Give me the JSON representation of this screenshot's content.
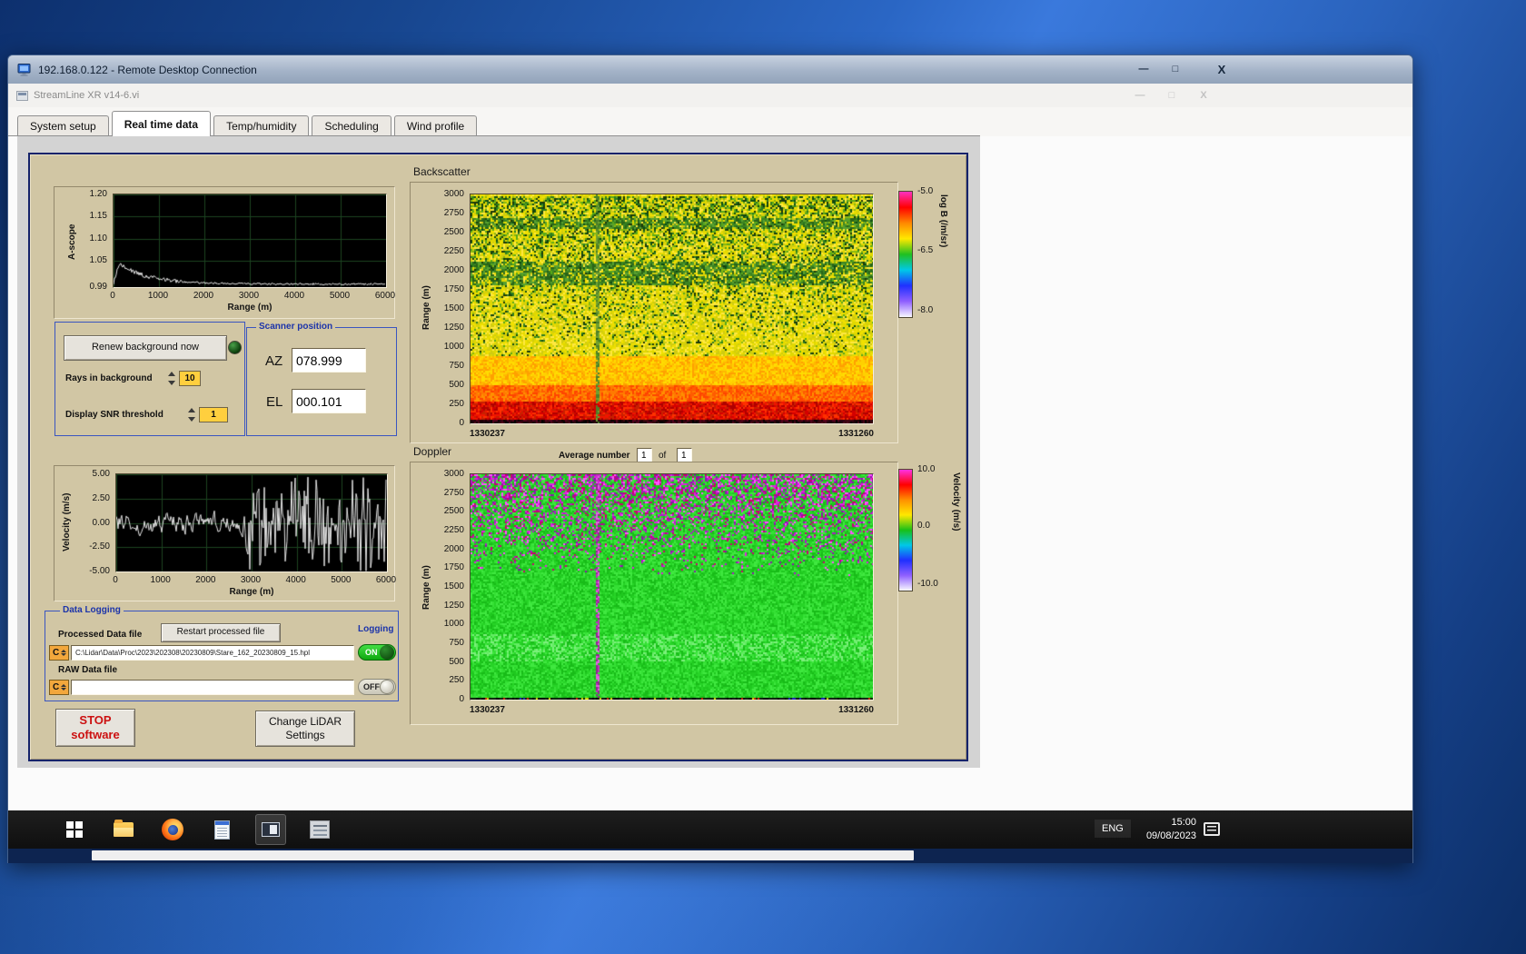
{
  "rdp_window": {
    "title": "192.168.0.122 - Remote Desktop Connection"
  },
  "icons": {
    "minimize": "—",
    "maximize": "□",
    "close": "X"
  },
  "app_window": {
    "title": "StreamLine XR v14-6.vi"
  },
  "tabs": [
    {
      "label": "System setup",
      "active": false
    },
    {
      "label": "Real time data",
      "active": true
    },
    {
      "label": "Temp/humidity",
      "active": false
    },
    {
      "label": "Scheduling",
      "active": false
    },
    {
      "label": "Wind profile",
      "active": false
    }
  ],
  "controls_panel": {
    "renew_button": "Renew background now",
    "rays_label": "Rays in background",
    "rays_value": "10",
    "snr_label": "Display SNR threshold",
    "snr_value": "1"
  },
  "scanner_position": {
    "title": "Scanner position",
    "az_label": "AZ",
    "az_value": "078.999",
    "el_label": "EL",
    "el_value": "000.101"
  },
  "doppler_header": {
    "average_label": "Average number",
    "average_value": "1",
    "of_label": "of",
    "average_total": "1"
  },
  "data_logging": {
    "title": "Data Logging",
    "processed_label": "Processed Data file",
    "restart_button": "Restart processed file",
    "logging_label": "Logging",
    "drive_letter": "C",
    "processed_path": "C:\\Lidar\\Data\\Proc\\2023\\202308\\20230809\\Stare_162_20230809_15.hpl",
    "processed_toggle": "ON",
    "raw_label": "RAW Data file",
    "raw_path": "",
    "raw_toggle": "OFF"
  },
  "buttons": {
    "stop_line1": "STOP",
    "stop_line2": "software",
    "change_line1": "Change LiDAR",
    "change_line2": "Settings"
  },
  "taskbar": {
    "language": "ENG",
    "time": "15:00",
    "date": "09/08/2023"
  },
  "chart_data": [
    {
      "id": "a_scope",
      "type": "line",
      "ylabel": "A-scope",
      "xlabel": "Range (m)",
      "xlim": [
        0,
        6000
      ],
      "ylim": [
        0.99,
        1.2
      ],
      "yticks": [
        "1.20",
        "1.15",
        "1.10",
        "1.05",
        "0.99"
      ],
      "xticks": [
        0,
        1000,
        2000,
        3000,
        4000,
        5000,
        6000
      ],
      "bg": "#000000",
      "grid_color": "#1c4420",
      "line_color": "#e6e6e6",
      "gen": {
        "floor": 0.997,
        "peak": 1.052,
        "tau": 650,
        "ramp": 120,
        "noise": 0.006
      },
      "description": "Background A-scope amplitude vs range: ~1.05 near 0 m decaying to ~1.00 beyond 1500 m with small noise."
    },
    {
      "id": "backscatter",
      "type": "heatmap",
      "title": "Backscatter",
      "ylabel": "Range (m)",
      "ylim": [
        0,
        3000
      ],
      "yticks": [
        "3000",
        "2750",
        "2500",
        "2250",
        "2000",
        "1750",
        "1500",
        "1250",
        "1000",
        "750",
        "500",
        "250",
        "0"
      ],
      "x_start_label": "1330237",
      "x_end_label": "1331260",
      "colorbar": {
        "label": "log B (/m/sr)",
        "ticks": [
          "-5.0",
          "-6.5",
          "-8.0"
        ],
        "colors": [
          "#ff30c0",
          "#ff0000",
          "#ff8800",
          "#ffe800",
          "#20c020",
          "#00c8e8",
          "#2030ff",
          "#9060ff",
          "#f8f8ff"
        ]
      },
      "paint": {
        "bands": [
          {
            "to": 55,
            "colors": [
              "#180004",
              "#3a0410",
              "#000000",
              "#52001e",
              "#240010"
            ]
          },
          {
            "to": 300,
            "colors": [
              "#d40000",
              "#ef1500",
              "#b00000",
              "#ff3000",
              "#c82000"
            ]
          },
          {
            "to": 520,
            "colors": [
              "#ff5c00",
              "#ff7a00",
              "#ff4400",
              "#ff9000"
            ]
          },
          {
            "to": 900,
            "colors": [
              "#ffb800",
              "#ffd000",
              "#ffa000",
              "#ffdc00"
            ]
          },
          {
            "to": 3000,
            "colors": [
              "#f0e000",
              "#e0d800",
              "#ffe840",
              "#d0cc10"
            ],
            "speckle": [
              "#58a818",
              "#2c7c20",
              "#0e4c14",
              "#88b810",
              "#1a3808"
            ],
            "density0": 0.1,
            "density1": 0.52
          }
        ],
        "dark_bands": [
          [
            1830,
            2130
          ],
          [
            2560,
            2700
          ]
        ],
        "dark_colors": [
          "#3c8420",
          "#2a6418",
          "#58a030"
        ],
        "vline_frac": 0.315,
        "vline_colors": [
          "#70a030",
          "#4c8028"
        ]
      },
      "description": "Time-height backscatter: strong red/orange returns below 500 m fading through yellow to speckled yellow-green aloft; faint disturbed column about one third across."
    },
    {
      "id": "velocity",
      "type": "line",
      "ylabel": "Velocity (m/s)",
      "xlabel": "Range (m)",
      "xlim": [
        0,
        6000
      ],
      "ylim": [
        -5,
        5
      ],
      "yticks": [
        "5.00",
        "2.50",
        "0.00",
        "-2.50",
        "-5.00"
      ],
      "xticks": [
        0,
        1000,
        2000,
        3000,
        4000,
        5000,
        6000
      ],
      "bg": "#000000",
      "grid_color": "#1c4420",
      "line_color": "#e6e6e6",
      "gen": {
        "noise_amp": 1.6,
        "spike_from": 2850,
        "spike_density": 0.78
      },
      "description": "Radial velocity vs range: small fluctuations about 0 out to ~2800 m, full-scale uncorrelated noise beyond."
    },
    {
      "id": "doppler",
      "type": "heatmap",
      "title": "Doppler",
      "ylabel": "Range (m)",
      "ylim": [
        0,
        3000
      ],
      "yticks": [
        "3000",
        "2750",
        "2500",
        "2250",
        "2000",
        "1750",
        "1500",
        "1250",
        "1000",
        "750",
        "500",
        "250",
        "0"
      ],
      "x_start_label": "1330237",
      "x_end_label": "1331260",
      "colorbar": {
        "label": "Velocity (m/s)",
        "ticks": [
          "10.0",
          "0.0",
          "-10.0"
        ],
        "colors": [
          "#ff30e0",
          "#ff0000",
          "#ff9000",
          "#ffe800",
          "#18c018",
          "#00c8e8",
          "#2030ff",
          "#9060ff",
          "#f8f8ff"
        ]
      },
      "paint": {
        "base": [
          "#27d427",
          "#1fc81f",
          "#35e035",
          "#18bc18",
          "#40e840"
        ],
        "light_band": {
          "from": 520,
          "to": 880,
          "colors": [
            "#64ec64",
            "#7cf07c"
          ],
          "density": 0.35
        },
        "speckle": {
          "from": 1650,
          "colors": [
            "#e020e0",
            "#b018c8",
            "#ff50ff",
            "#cc0070",
            "#8818a8"
          ],
          "density1": 0.55
        },
        "vline_frac": 0.315,
        "vline_colors": [
          "#c030c0",
          "#902890",
          "#e060e0"
        ],
        "bottom": {
          "height": 45,
          "dark": [
            "#000000",
            "#141414",
            "#082008"
          ],
          "bright": [
            "#d02000",
            "#d8d800",
            "#2020c0"
          ],
          "dark_prob": 0.85
        }
      },
      "description": "Time-height Doppler velocity: near-zero (green) everywhere, magenta noise aloft above ~1800 m, narrow disturbed magenta column about one third across, dark speckled lowest gate."
    }
  ]
}
